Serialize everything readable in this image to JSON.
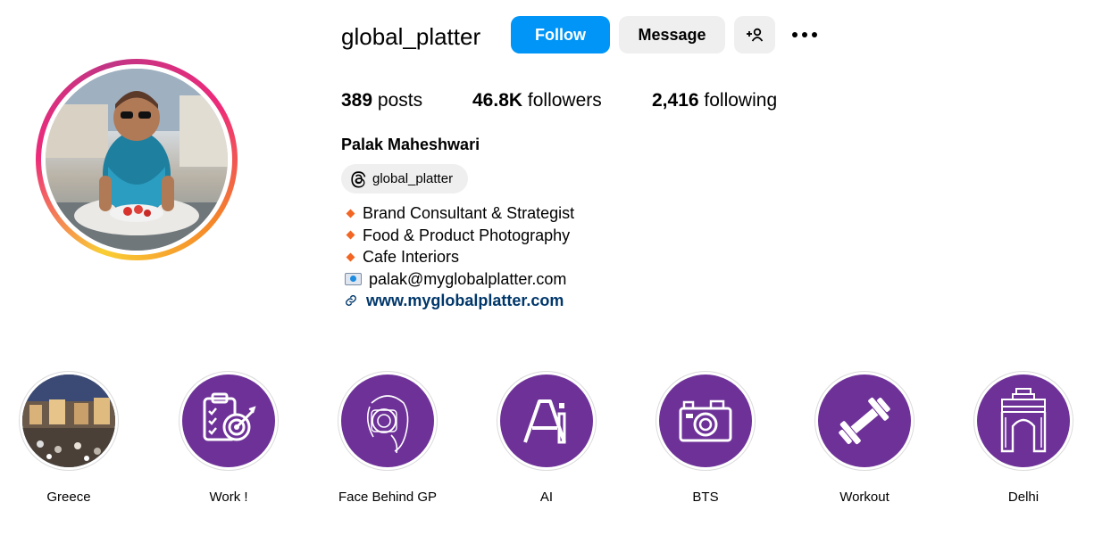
{
  "profile": {
    "username": "global_platter",
    "follow_label": "Follow",
    "message_label": "Message",
    "add_user_icon": "add-user-icon",
    "more_icon": "more-options-icon",
    "stats": {
      "posts_count": "389",
      "posts_label": "posts",
      "followers_count": "46.8K",
      "followers_label": "followers",
      "following_count": "2,416",
      "following_label": "following"
    },
    "full_name": "Palak Maheshwari",
    "threads_handle": "global_platter",
    "bio": [
      "Brand Consultant & Strategist",
      "Food & Product Photography",
      "Cafe Interiors"
    ],
    "email": "palak@myglobalplatter.com",
    "website": "www.myglobalplatter.com"
  },
  "highlights": [
    {
      "label": "Greece",
      "icon": "greece-photo"
    },
    {
      "label": "Work !",
      "icon": "clipboard-target-icon"
    },
    {
      "label": "Face Behind GP",
      "icon": "camera-face-icon"
    },
    {
      "label": "AI",
      "icon": "ai-letters-icon"
    },
    {
      "label": "BTS",
      "icon": "camera-icon"
    },
    {
      "label": "Workout",
      "icon": "dumbbell-icon"
    },
    {
      "label": "Delhi",
      "icon": "india-gate-icon"
    }
  ],
  "colors": {
    "follow_button": "#0095f6",
    "secondary_button": "#efefef",
    "highlight_bg": "#6d3198",
    "link": "#00376b",
    "bullet": "#f26522"
  }
}
